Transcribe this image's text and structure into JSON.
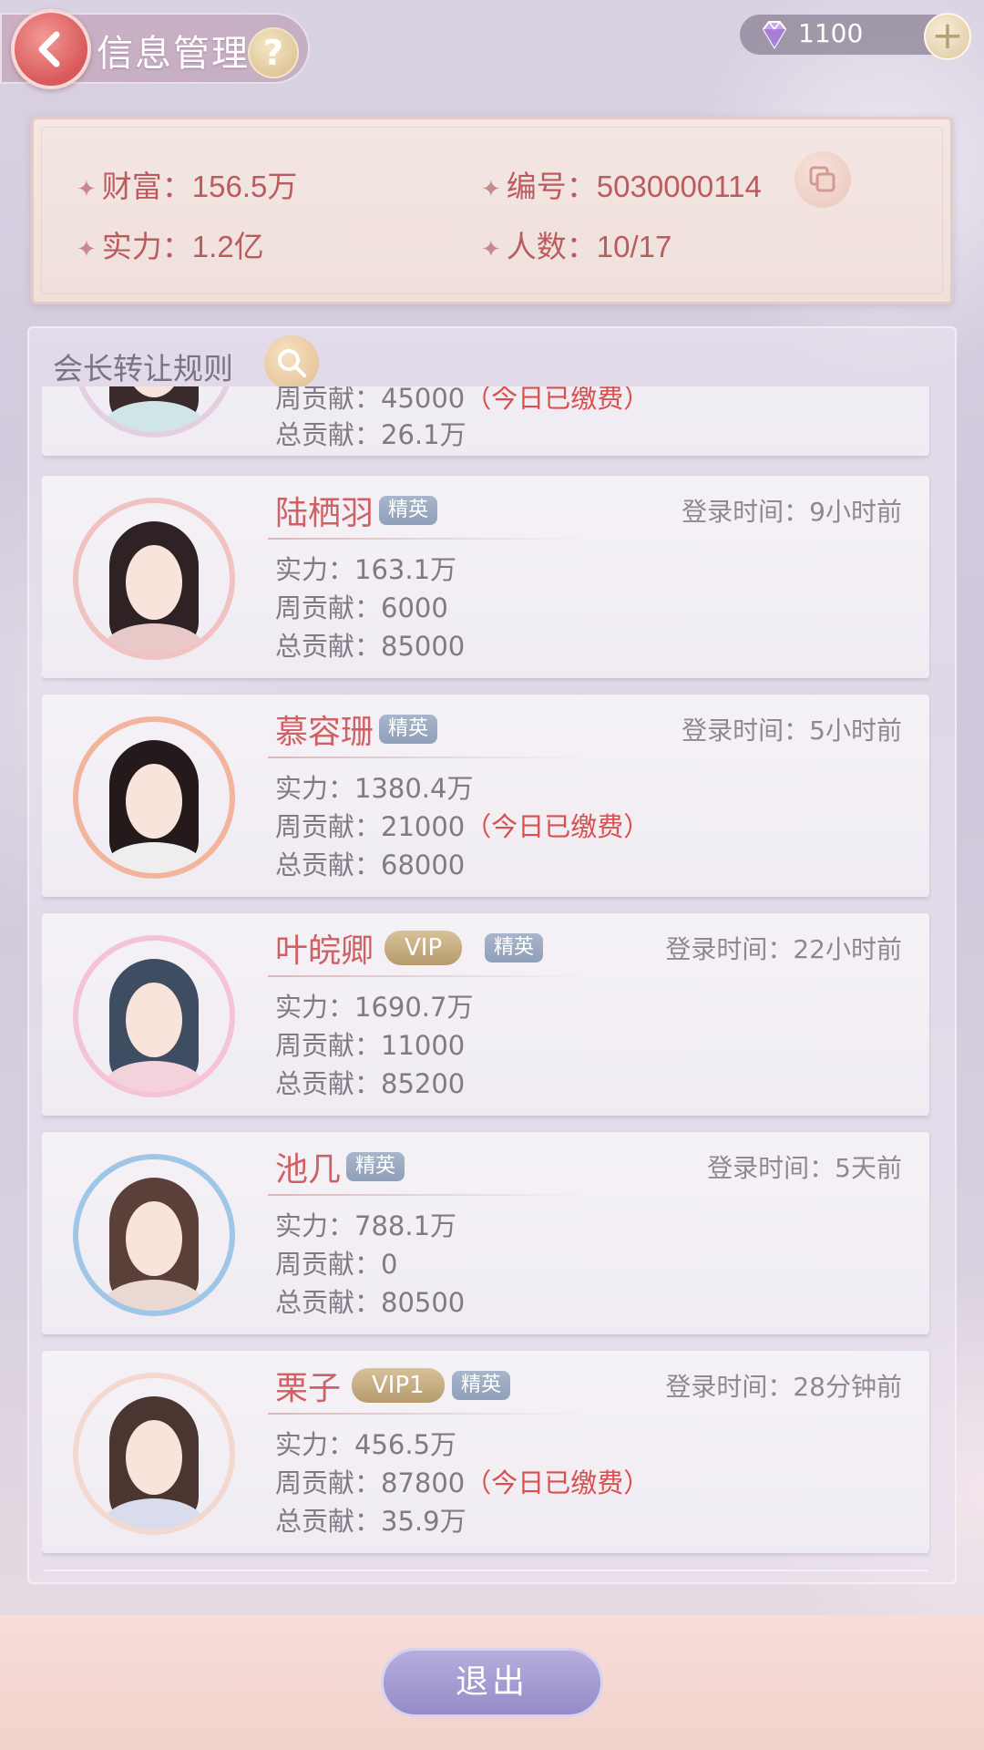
{
  "header": {
    "title": "信息管理",
    "help_label": "?",
    "currency_amount": "1100",
    "currency_icon": "diamond-icon",
    "add_label": "+"
  },
  "info": {
    "wealth": "财富：156.5万",
    "id": "编号：5030000114",
    "power": "实力：1.2亿",
    "members": "人数：10/17"
  },
  "rule_label": "会长转让规则",
  "members": [
    {
      "name": "",
      "badges": [],
      "login": "",
      "power": "",
      "weekly": "周贡献：45000",
      "weekly_paid": "（今日已缴费）",
      "total": "总贡献：26.1万"
    },
    {
      "name": "陆栖羽",
      "badges": [
        "精英"
      ],
      "login": "登录时间：9小时前",
      "power": "实力：163.1万",
      "weekly": "周贡献：6000",
      "weekly_paid": "",
      "total": "总贡献：85000"
    },
    {
      "name": "慕容珊",
      "badges": [
        "精英"
      ],
      "login": "登录时间：5小时前",
      "power": "实力：1380.4万",
      "weekly": "周贡献：21000",
      "weekly_paid": "（今日已缴费）",
      "total": "总贡献：68000"
    },
    {
      "name": "叶皖卿",
      "vip": "VIP",
      "badges": [
        "精英"
      ],
      "login": "登录时间：22小时前",
      "power": "实力：1690.7万",
      "weekly": "周贡献：11000",
      "weekly_paid": "",
      "total": "总贡献：85200"
    },
    {
      "name": "池几",
      "badges": [
        "精英"
      ],
      "login": "登录时间：5天前",
      "power": "实力：788.1万",
      "weekly": "周贡献：0",
      "weekly_paid": "",
      "total": "总贡献：80500"
    },
    {
      "name": "栗子",
      "vip": "VIP1",
      "badges": [
        "精英"
      ],
      "login": "登录时间：28分钟前",
      "power": "实力：456.5万",
      "weekly": "周贡献：87800",
      "weekly_paid": "（今日已缴费）",
      "total": "总贡献：35.9万"
    }
  ],
  "footer": {
    "exit_label": "退出"
  },
  "colors": {
    "accent_red": "#cf6164",
    "paid_red": "#d9514f",
    "elite_badge": "#98a6bd",
    "vip_badge": "#c6ad80",
    "exit_button": "#a59dd2"
  }
}
